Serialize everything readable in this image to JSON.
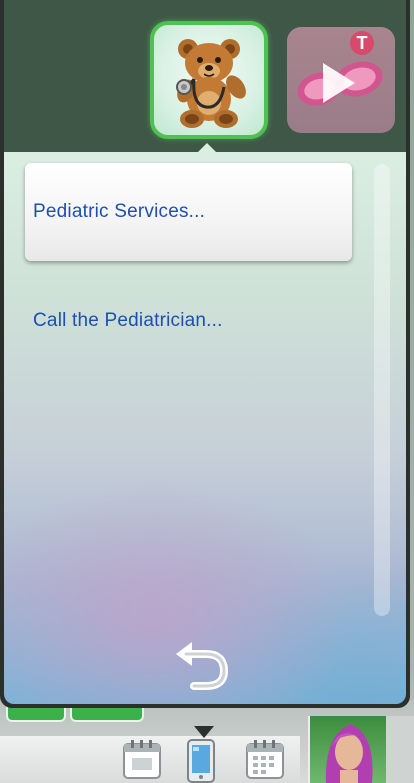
{
  "menu": {
    "items": [
      {
        "label": "Pediatric Services..."
      },
      {
        "label": "Call the Pediatrician..."
      }
    ]
  },
  "icons": {
    "active_tab": "teddy-bear-stethoscope-icon",
    "inactive_tab": "pink-sunglasses-icon",
    "inactive_tab_badge": "T",
    "back": "back-arrow-icon",
    "calendar_1": "calendar-icon",
    "phone": "phone-icon",
    "calendar_2": "calendar-grid-icon"
  },
  "colors": {
    "accent_green": "#4fc152",
    "link_blue": "#1d4fb0",
    "badge_pink": "#d64a6b",
    "panel_dark": "#2b302d",
    "header_green": "#3f5746"
  }
}
